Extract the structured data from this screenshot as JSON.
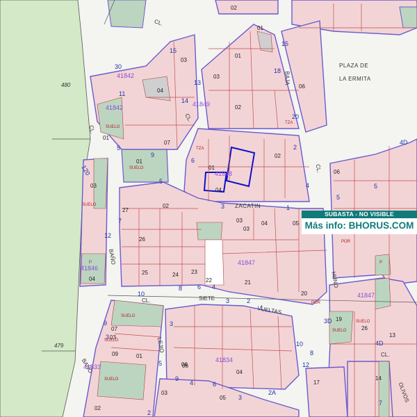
{
  "banner": {
    "status": "SUBASTA - NO VISIBLE",
    "info": "Más info: BHORUS.COM"
  },
  "streets": {
    "plaza_line1": "PLAZA DE",
    "plaza_line2": "LA ERMITA",
    "baja": "BAJA",
    "cl_1": "CL.",
    "cl_2": "CL.",
    "cl_3": "CL.",
    "cl_4": "CL.",
    "cl_5": "CL.",
    "cl_6": "CL.",
    "zacatin": "ZACATIN",
    "bano": "BAÑO",
    "bano2": "BAÑO",
    "siete": "SIETE",
    "vueltas": "VUELTAS",
    "lejio": "LEJIO",
    "huno": "HUNO",
    "olivos": "OLIVOS"
  },
  "blocks": [
    "41842",
    "41842",
    "41849",
    "41848",
    "41847",
    "41846",
    "41847",
    "41833",
    "41834"
  ],
  "terrain": [
    "480",
    "479"
  ],
  "parcels": [
    "02",
    "01",
    "02",
    "03",
    "01",
    "03",
    "06",
    "04",
    "07",
    "01",
    "01",
    "02",
    "01",
    "03",
    "06",
    "03",
    "27",
    "02",
    "26",
    "25",
    "24",
    "23",
    "22",
    "21",
    "20",
    "03",
    "04",
    "05",
    "06",
    "19",
    "26",
    "13",
    "14",
    "17",
    "01",
    "03",
    "07",
    "09",
    "03",
    "06",
    "04",
    "04",
    "04",
    "05",
    "02"
  ],
  "house_numbers": [
    "30",
    "15",
    "13",
    "14",
    "11",
    "15",
    "18",
    "20",
    "5",
    "9",
    "5",
    "7",
    "6",
    "3",
    "2",
    "1",
    "10",
    "8",
    "6",
    "4",
    "12",
    "3",
    "1",
    "4",
    "2",
    "3",
    "5",
    "9",
    "3",
    "8",
    "9",
    "4",
    "6",
    "3",
    "2A",
    "2",
    "10",
    "12",
    "4D",
    "4D",
    "3D",
    "5",
    "5",
    "7",
    "120"
  ],
  "tags": [
    "SUELO",
    "SUELO",
    "SUELO",
    "SUELO",
    "SUELO",
    "SUELO",
    "SUELO",
    "SUELO",
    "TZA",
    "TZA",
    "POR",
    "POR",
    "P",
    "P"
  ]
}
